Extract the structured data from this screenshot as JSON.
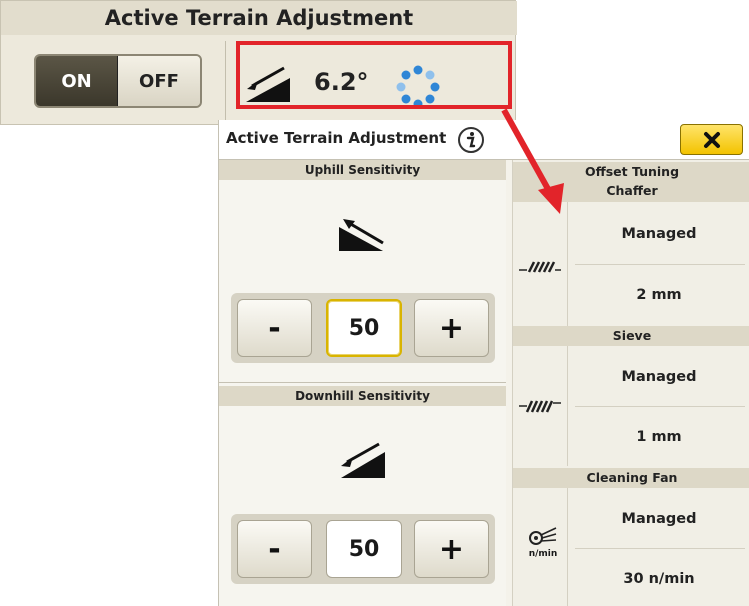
{
  "top_widget": {
    "title": "Active Terrain Adjustment",
    "toggle_on_label": "ON",
    "toggle_off_label": "OFF",
    "toggle_selected": "ON",
    "angle": "6.2°",
    "slope_icon": "downhill-slope-icon",
    "status_icon": "spinner-icon"
  },
  "panel": {
    "title": "Active Terrain Adjustment",
    "info_icon": "info-icon",
    "close_icon": "close-icon",
    "uphill": {
      "header": "Uphill Sensitivity",
      "icon": "uphill-slope-icon",
      "minus_label": "-",
      "plus_label": "+",
      "value": "50"
    },
    "downhill": {
      "header": "Downhill Sensitivity",
      "icon": "downhill-slope-icon",
      "minus_label": "-",
      "plus_label": "+",
      "value": "50"
    },
    "offset_tuning": {
      "header_line1": "Offset Tuning",
      "chaffer": {
        "header": "Chaffer",
        "icon": "chaffer-icon",
        "mode": "Managed",
        "value": "2 mm"
      },
      "sieve": {
        "header": "Sieve",
        "icon": "sieve-icon",
        "mode": "Managed",
        "value": "1 mm"
      },
      "cleaning_fan": {
        "header": "Cleaning Fan",
        "icon": "cleaning-fan-icon",
        "icon_text": "n/min",
        "mode": "Managed",
        "value": "30 n/min"
      }
    }
  },
  "colors": {
    "highlight": "#e2242a",
    "close_button": "#f3c300",
    "section_header": "#ddd8c7",
    "toggle_on": "#4a4538"
  }
}
